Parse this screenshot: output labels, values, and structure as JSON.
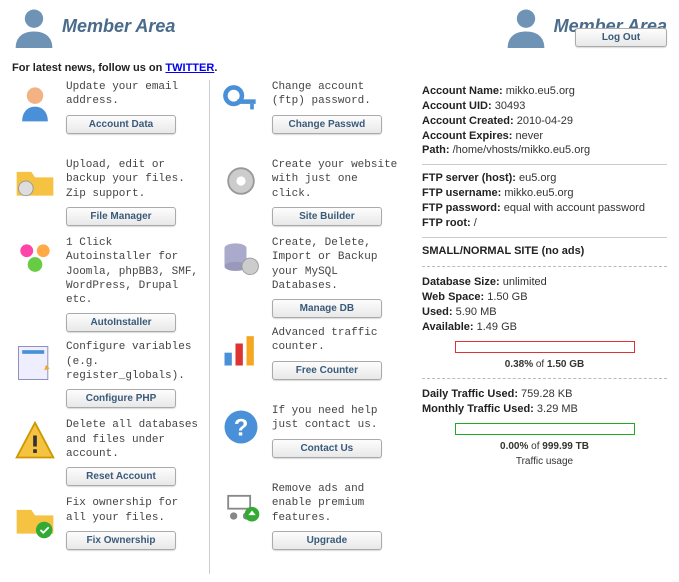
{
  "header": {
    "title": "Member Area",
    "logout": "Log Out"
  },
  "sub": {
    "text_prefix": "For latest ",
    "news": "news",
    "mid": ", follow us on ",
    "twitter": "TWITTER",
    "suffix": "."
  },
  "items_left": [
    {
      "desc": "Update your email address.",
      "btn": "Account Data"
    },
    {
      "desc": "Upload, edit or backup your files. Zip support.",
      "btn": "File Manager"
    },
    {
      "desc": "1 Click Autoinstaller for Joomla, phpBB3, SMF, WordPress, Drupal etc.",
      "btn": "AutoInstaller"
    },
    {
      "desc": "Configure variables (e.g. register_globals).",
      "btn": "Configure PHP"
    },
    {
      "desc": "Delete all databases and files under account.",
      "btn": "Reset Account"
    },
    {
      "desc": "Fix ownership for all your files.",
      "btn": "Fix Ownership"
    }
  ],
  "items_right": [
    {
      "desc": "Change account (ftp) password.",
      "btn": "Change Passwd"
    },
    {
      "desc": "Create your website with just one click.",
      "btn": "Site Builder"
    },
    {
      "desc": "Create, Delete, Import or Backup your MySQL Databases.",
      "btn": "Manage DB"
    },
    {
      "desc": "Advanced traffic counter.",
      "btn": "Free Counter"
    },
    {
      "desc": "If you need help just contact us.",
      "btn": "Contact Us"
    },
    {
      "desc": "Remove ads and enable premium features.",
      "btn": "Upgrade"
    }
  ],
  "account": {
    "name_lbl": "Account Name:",
    "name": "mikko.eu5.org",
    "uid_lbl": "Account UID:",
    "uid": "30493",
    "created_lbl": "Account Created:",
    "created": "2010-04-29",
    "expires_lbl": "Account Expires:",
    "expires": "never",
    "path_lbl": "Path:",
    "path": "/home/vhosts/mikko.eu5.org"
  },
  "ftp": {
    "server_lbl": "FTP server (host):",
    "server": "eu5.org",
    "user_lbl": "FTP username:",
    "user": "mikko.eu5.org",
    "pw_lbl": "FTP password:",
    "pw": "equal with account password",
    "root_lbl": "FTP root:",
    "root": "/"
  },
  "site": {
    "heading": "SMALL/NORMAL SITE (no ads)",
    "dbsize_lbl": "Database Size:",
    "dbsize": "unlimited",
    "webspace_lbl": "Web Space:",
    "webspace": "1.50 GB",
    "used_lbl": "Used:",
    "used": "5.90 MB",
    "avail_lbl": "Available:",
    "avail": "1.49 GB",
    "bar1_pct": "0.38%",
    "bar1_of": " of ",
    "bar1_total": "1.50 GB",
    "daily_lbl": "Daily Traffic Used:",
    "daily": "759.28 KB",
    "monthly_lbl": "Monthly Traffic Used:",
    "monthly": "3.29 MB",
    "bar2_pct": "0.00%",
    "bar2_of": " of ",
    "bar2_total": "999.99 TB",
    "traffic_caption": "Traffic usage"
  }
}
